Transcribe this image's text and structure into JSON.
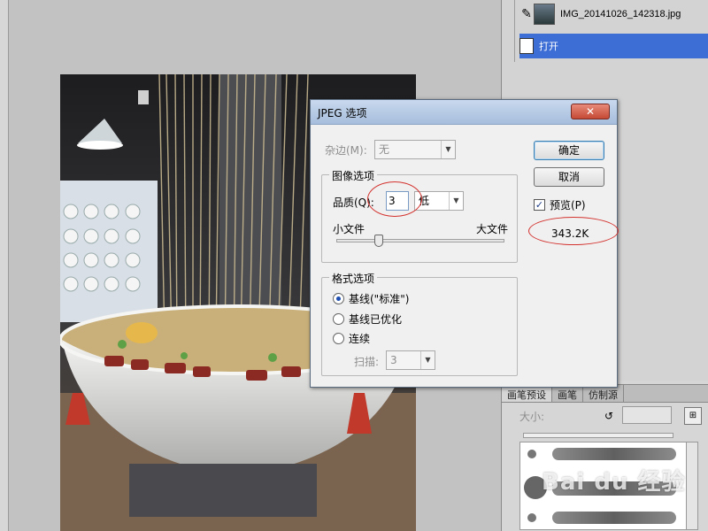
{
  "history": {
    "snapshot_name": "IMG_20141026_142318.jpg",
    "step_open": "打开"
  },
  "brush_panel": {
    "tabs": [
      "画笔预设",
      "画笔",
      "仿制源"
    ],
    "size_label": "大小:"
  },
  "watermark": "Bai du 经验",
  "dialog": {
    "title": "JPEG 选项",
    "close_label": "✕",
    "matte_label": "杂边(M):",
    "matte_value": "无",
    "image_options_legend": "图像选项",
    "quality_label": "品质(Q):",
    "quality_value": "3",
    "quality_preset": "低",
    "small_file_label": "小文件",
    "large_file_label": "大文件",
    "format_options_legend": "格式选项",
    "format_options": [
      {
        "label": "基线(\"标准\")",
        "checked": true
      },
      {
        "label": "基线已优化",
        "checked": false
      },
      {
        "label": "连续",
        "checked": false
      }
    ],
    "scans_label": "扫描:",
    "scans_value": "3",
    "ok_label": "确定",
    "cancel_label": "取消",
    "preview_label": "预览(P)",
    "preview_checked": true,
    "file_size": "343.2K",
    "quality_slider_fraction": 0.25
  },
  "colors": {
    "accent_selection": "#3d6ed6",
    "annotation": "#d3322e",
    "close_button": "#c44a35"
  }
}
